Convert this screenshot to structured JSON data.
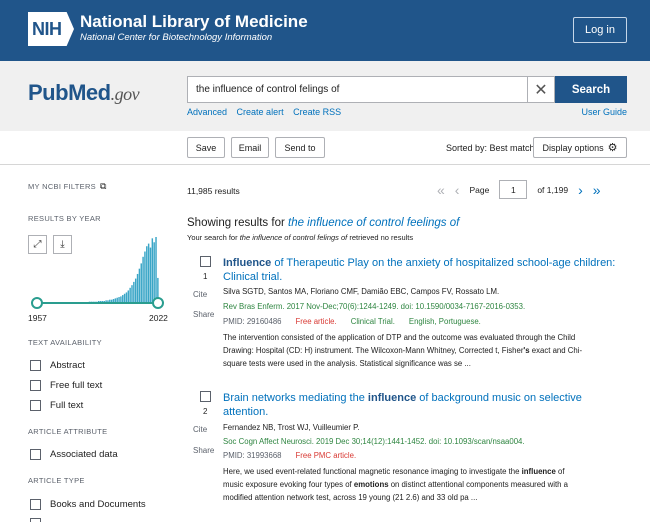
{
  "header": {
    "logo_text": "NIH",
    "title": "National Library of Medicine",
    "subtitle": "National Center for Biotechnology Information",
    "login_label": "Log in"
  },
  "search": {
    "logo_pub": "Pub",
    "logo_med": "Med",
    "logo_gov": ".gov",
    "query": "the influence of control felings of",
    "clear_icon": "close-icon",
    "button_label": "Search",
    "links": [
      "Advanced",
      "Create alert",
      "Create RSS"
    ],
    "user_guide": "User Guide"
  },
  "toolbar": {
    "save_label": "Save",
    "email_label": "Email",
    "send_label": "Send to",
    "sorted_label": "Sorted by: Best match",
    "display_label": "Display options",
    "display_icon": "gear-icon"
  },
  "sidebar": {
    "my_ncbi": "MY NCBI FILTERS",
    "results_by_year": "RESULTS BY YEAR",
    "year_start": "1957",
    "year_end": "2022",
    "histogram": [
      1,
      1,
      1,
      1,
      1,
      1,
      1,
      1,
      1,
      1,
      1,
      1,
      1,
      1,
      1,
      1,
      1,
      1,
      1,
      1,
      1,
      1,
      1,
      1,
      1,
      1,
      1,
      1,
      2,
      2,
      2,
      2,
      2,
      3,
      3,
      3,
      3,
      4,
      4,
      5,
      5,
      6,
      7,
      8,
      9,
      10,
      12,
      14,
      16,
      19,
      23,
      27,
      32,
      37,
      44,
      52,
      60,
      70,
      78,
      86,
      90,
      84,
      98,
      92,
      100,
      38
    ],
    "text_availability": "TEXT AVAILABILITY",
    "availability_items": [
      "Abstract",
      "Free full text",
      "Full text"
    ],
    "article_attribute": "ARTICLE ATTRIBUTE",
    "attribute_items": [
      "Associated data"
    ],
    "article_type": "ARTICLE TYPE",
    "type_items": [
      "Books and Documents"
    ]
  },
  "results": {
    "count": "11,985 results",
    "page_label": "Page",
    "page_value": "1",
    "of_pages": "of 1,199",
    "showing_prefix": "Showing results for",
    "showing_query": "the influence of control feelings of",
    "notice_prefix": "Your search for",
    "notice_query": "the influence of control felings of",
    "notice_suffix": "retrieved no results",
    "articles": [
      {
        "num": "1",
        "cite": "Cite",
        "share": "Share",
        "title_hl": "Influence",
        "title_rest": " of Therapeutic Play on the anxiety of hospitalized school-age children: Clinical trial.",
        "authors": "Silva SGTD, Santos MA, Floriano CMF, Damião EBC, Campos FV, Rossato LM.",
        "journal": "Rev Bras Enferm. 2017 Nov-Dec;70(6):1244-1249. doi: 10.1590/0034-7167-2016-0353.",
        "pmid": "PMID: 29160486",
        "free": "Free article.",
        "type": "Clinical Trial.",
        "lang": "English, Portuguese.",
        "snip1": "The intervention consisted of the application of DTP and the outcome was evaluated through the Child",
        "snip2": "Drawing: Hospital (CD: H) instrument. The Wilcoxon-Mann Whitney, Corrected t, Fisher",
        "snip2_b": "'s",
        "snip2_c": " exact and Chi-",
        "snip3": "square tests were used in the analysis. Statistical significance was se ..."
      },
      {
        "num": "2",
        "cite": "Cite",
        "share": "Share",
        "title_pre": "Brain networks mediating the ",
        "title_hl": "influence",
        "title_rest": " of background music on selective attention.",
        "authors": "Fernandez NB, Trost WJ, Vuilleumier P.",
        "journal": "Soc Cogn Affect Neurosci. 2019 Dec 30;14(12):1441-1452. doi: 10.1093/scan/nsaa004.",
        "pmid": "PMID: 31993668",
        "free": "Free PMC article.",
        "snip1_a": "Here, we used event-related functional magnetic resonance imaging to investigate the ",
        "snip1_b": "influence",
        "snip1_c": " of",
        "snip2_a": "music exposure evoking four types of ",
        "snip2_b": "emotions",
        "snip2_c": " on distinct attentional components measured with a",
        "snip3": "modified attention network test, across 19 young (21 2.6) and 33 old pa ..."
      }
    ]
  }
}
